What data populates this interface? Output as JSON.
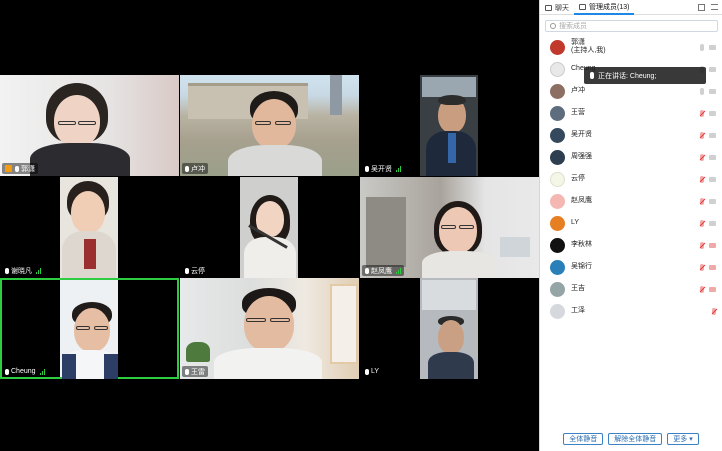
{
  "panel": {
    "tab_chat": "聊天",
    "tab_members": "管理成员(13)",
    "search_placeholder": "搜索成员",
    "toast_text": "正在讲话: Cheung;",
    "footer": {
      "mute_all": "全体静音",
      "unmute_all": "解除全体静音",
      "more": "更多 ▾"
    },
    "participants": [
      {
        "name": "郭潇",
        "sub": "(主持人,我)",
        "avatar_color": "#c0392b",
        "mic_off": false,
        "cam_off": false
      },
      {
        "name": "Cheung",
        "sub": "",
        "avatar_color": "#e8e8e8",
        "mic_off": false,
        "cam_off": false
      },
      {
        "name": "卢冲",
        "sub": "",
        "avatar_color": "#8d6e63",
        "mic_off": false,
        "cam_off": false
      },
      {
        "name": "王营",
        "sub": "",
        "avatar_color": "#5d6d7e",
        "mic_off": true,
        "cam_off": false
      },
      {
        "name": "吴开贤",
        "sub": "",
        "avatar_color": "#34495e",
        "mic_off": true,
        "cam_off": false
      },
      {
        "name": "周强强",
        "sub": "",
        "avatar_color": "#2c3e50",
        "mic_off": true,
        "cam_off": false
      },
      {
        "name": "云停",
        "sub": "",
        "avatar_color": "#f4f6e8",
        "mic_off": true,
        "cam_off": false
      },
      {
        "name": "赵凤鹰",
        "sub": "",
        "avatar_color": "#f5b7b1",
        "mic_off": true,
        "cam_off": false
      },
      {
        "name": "LY",
        "sub": "",
        "avatar_color": "#e67e22",
        "mic_off": true,
        "cam_off": false
      },
      {
        "name": "李秋林",
        "sub": "",
        "avatar_color": "#111111",
        "mic_off": true,
        "cam_off": true
      },
      {
        "name": "吴锦行",
        "sub": "",
        "avatar_color": "#2980b9",
        "mic_off": true,
        "cam_off": true
      },
      {
        "name": "王吉",
        "sub": "",
        "avatar_color": "#95a5a6",
        "mic_off": true,
        "cam_off": true
      },
      {
        "name": "工泽",
        "sub": "",
        "avatar_color": "#d5d8dc",
        "mic_off": true,
        "cam_off": null
      }
    ]
  },
  "videos": [
    {
      "name": "郭潇",
      "host": true,
      "signal": false
    },
    {
      "name": "卢冲",
      "host": false,
      "signal": false
    },
    {
      "name": "吴开贤",
      "host": false,
      "signal": true
    },
    {
      "name": "谢晓凡",
      "host": false,
      "signal": true
    },
    {
      "name": "云停",
      "host": false,
      "signal": false
    },
    {
      "name": "赵凤鹰",
      "host": false,
      "signal": true
    },
    {
      "name": "Cheung",
      "host": false,
      "signal": true
    },
    {
      "name": "王雷",
      "host": false,
      "signal": false
    },
    {
      "name": "LY",
      "host": false,
      "signal": false
    }
  ]
}
